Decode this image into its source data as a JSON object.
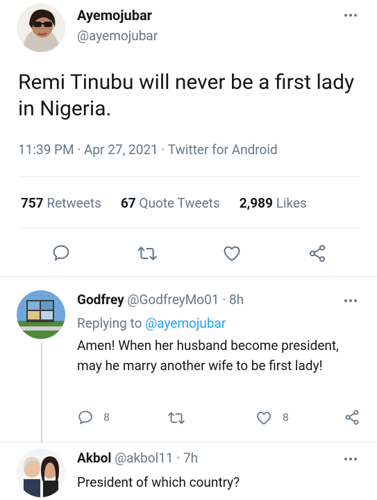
{
  "main_tweet": {
    "author_name": "Ayemojubar",
    "author_handle": "@ayemojubar",
    "text": "Remi Tinubu will never be a first lady in Nigeria.",
    "meta": "11:39 PM · Apr 27, 2021 · Twitter for Android",
    "stats": {
      "retweets_count": "757",
      "retweets_label": "Retweets",
      "quotes_count": "67",
      "quotes_label": "Quote Tweets",
      "likes_count": "2,989",
      "likes_label": "Likes"
    }
  },
  "replies": [
    {
      "author_name": "Godfrey",
      "author_handle": "@GodfreyMo01",
      "time": "· 8h",
      "replying_prefix": "Replying to",
      "replying_mention": "@ayemojubar",
      "text": "Amen! When her husband become president, may he marry another wife to be first lady!",
      "reply_count": "8",
      "like_count": "8"
    },
    {
      "author_name": "Akbol",
      "author_handle": "@akbol11",
      "time": "· 7h",
      "text": "President of which country?"
    }
  ],
  "colors": {
    "secondary_text": "#657786",
    "link": "#1da1f2",
    "divider": "#e6ecf0"
  },
  "icons": [
    "reply-icon",
    "retweet-icon",
    "like-icon",
    "share-icon",
    "more-icon"
  ]
}
